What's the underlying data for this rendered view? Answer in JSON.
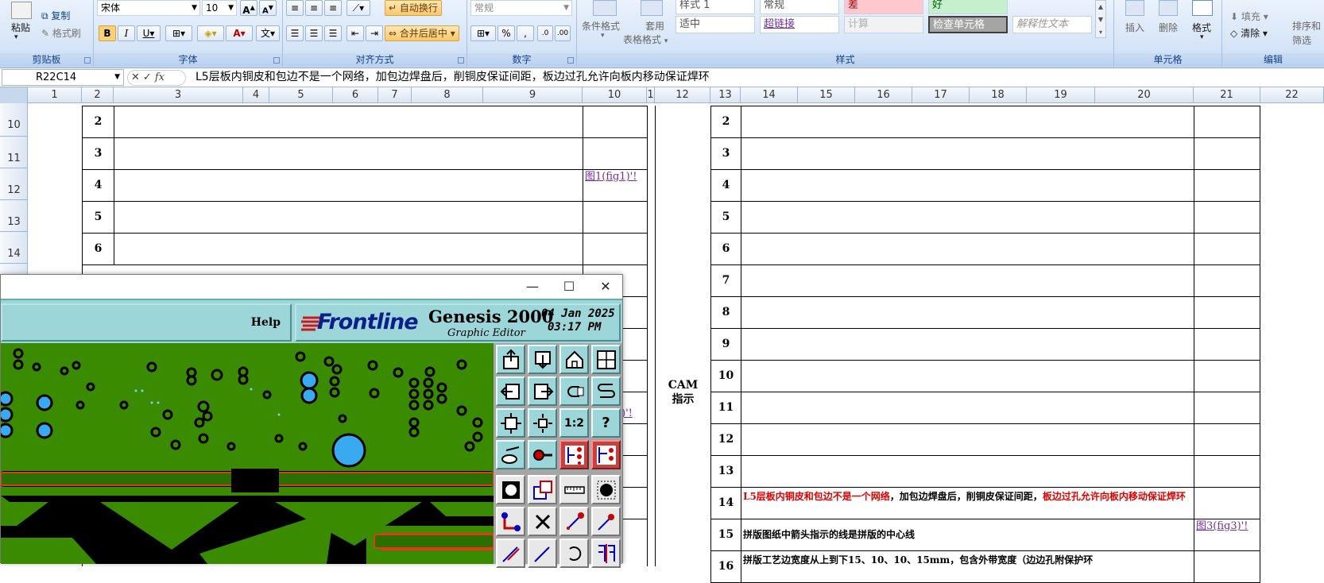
{
  "ribbon": {
    "clipboard": {
      "paste": "粘贴",
      "copy": "复制",
      "format_painter": "格式刷",
      "label": "剪贴板"
    },
    "font": {
      "name": "宋体",
      "size": "10",
      "label": "字体"
    },
    "alignment": {
      "wrap": "自动换行",
      "merge": "合并后居中",
      "label": "对齐方式"
    },
    "number": {
      "format": "常规",
      "percent": "%",
      "comma": ",",
      "label": "数字"
    },
    "styles": {
      "conditional": "条件格式",
      "table_format": "套用",
      "table_format2": "表格格式",
      "cells": [
        "样式 1",
        "常规",
        "差",
        "好",
        "适中",
        "超链接",
        "计算",
        "检查单元格",
        "解释性文本"
      ],
      "label": "样式"
    },
    "cells_group": {
      "insert": "插入",
      "delete": "删除",
      "format": "格式",
      "label": "单元格"
    },
    "editing": {
      "fill": "填充",
      "clear": "清除",
      "sort": "排序和",
      "filter": "筛选",
      "label": "编辑"
    }
  },
  "formula_bar": {
    "name_box": "R22C14",
    "fx": "fx",
    "content": "L5层板内铜皮和包边不是一个网络，加包边焊盘后，削铜皮保证间距，板边过孔允许向板内移动保证焊环"
  },
  "col_headers": [
    "1",
    "2",
    "3",
    "4",
    "5",
    "6",
    "7",
    "8",
    "9",
    "10",
    "1",
    "12",
    "13",
    "14",
    "15",
    "16",
    "17",
    "18",
    "19",
    "20",
    "21",
    "22"
  ],
  "row_headers": [
    "10",
    "11",
    "12",
    "13",
    "14"
  ],
  "left_table": {
    "nums": [
      "2",
      "3",
      "4",
      "5",
      "6"
    ],
    "link1": "图1(fig1)'!",
    "link_partial": ")'!"
  },
  "right_table": {
    "section_label_1": "CAM",
    "section_label_2": "指示",
    "nums": [
      "2",
      "3",
      "4",
      "5",
      "6",
      "7",
      "8",
      "9",
      "10",
      "11",
      "12",
      "13",
      "14",
      "15",
      "16"
    ],
    "row14_red1": "L5层板内铜皮和包边不是一个网络",
    "row14_black": "，加包边焊盘后，削铜皮保证间距，",
    "row14_red2": "板边过孔允许向板内移动保证焊环",
    "row15_text": "拼版图纸中箭头指示的线是拼版的中心线",
    "row15_link": "图3(fig3)'!",
    "row16_text": "拼版工艺边宽度从上到下15、10、10、15mm，包含外带宽度（边边孔附保护环"
  },
  "genesis": {
    "help": "Help",
    "brand": "Frontline",
    "product": "Genesis 2000",
    "subtitle": "Graphic Editor",
    "date": "04 Jan 2025",
    "time": "03:17 PM",
    "minimize": "—",
    "maximize": "☐",
    "close": "✕",
    "ratio_btn": "1:2",
    "help_btn": "?"
  },
  "colors": {
    "pcb_green": "#3b8b00",
    "teal": "#9dd6d9",
    "hyperlink": "#7030a0",
    "red_text": "#e00000"
  }
}
